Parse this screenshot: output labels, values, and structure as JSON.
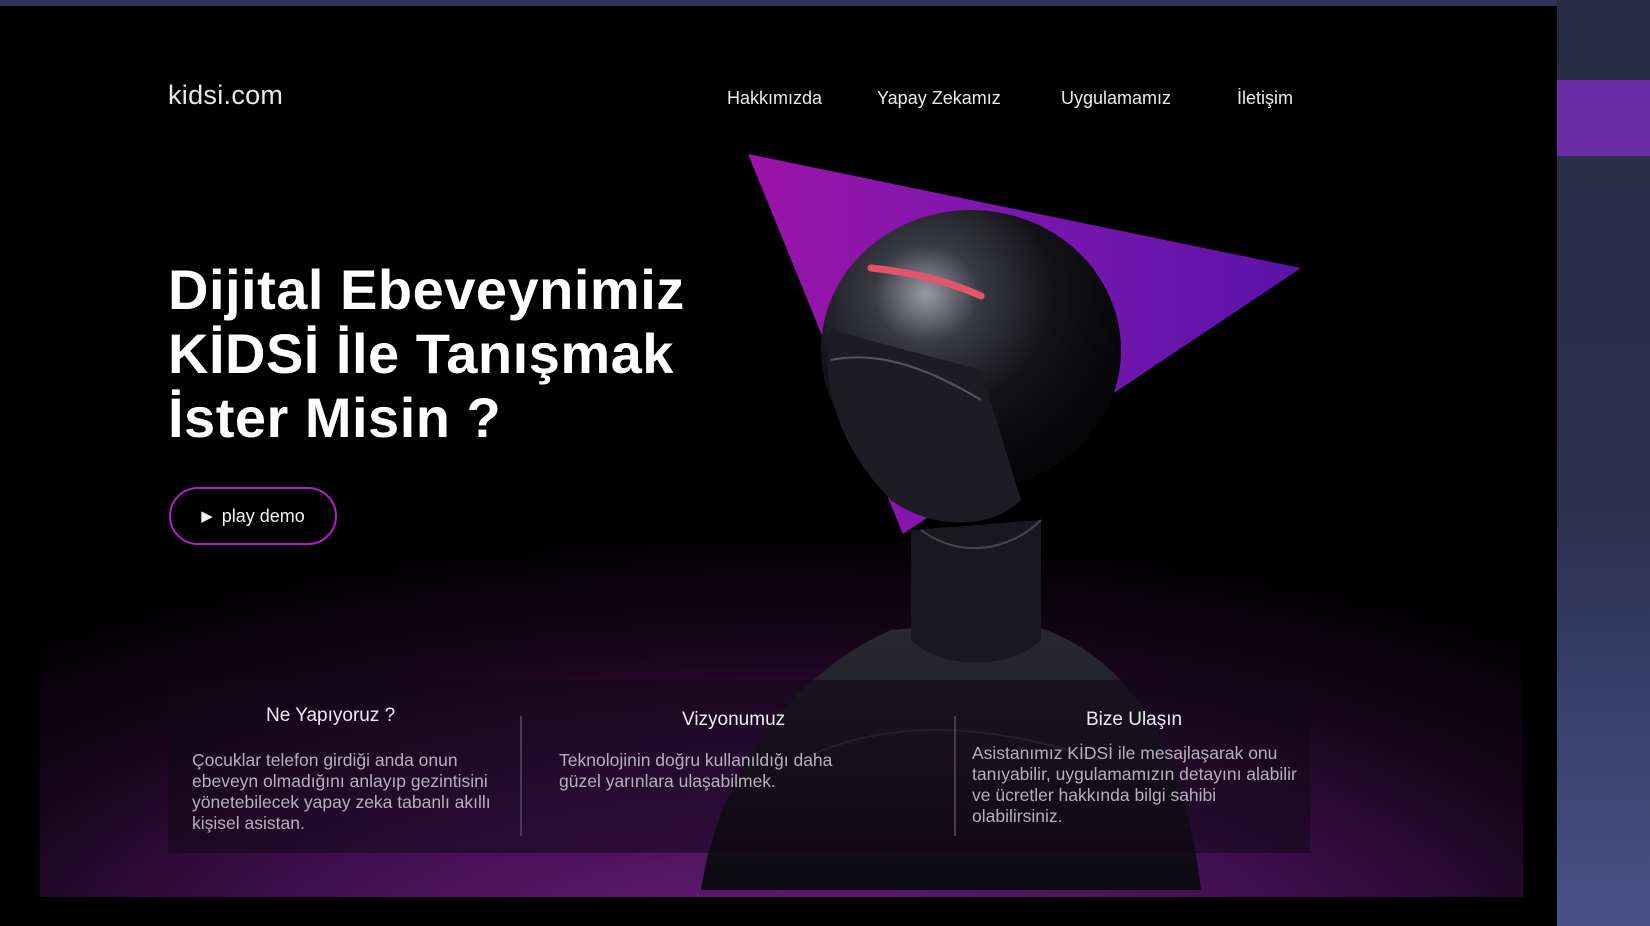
{
  "site": {
    "logo": "kidsi.com"
  },
  "nav": {
    "items": [
      "Hakkımızda",
      "Yapay Zekamız",
      "Uygulamamız",
      "İletişim"
    ]
  },
  "hero": {
    "title_lines": [
      "Dijital Ebeveynimiz",
      "KİDSİ İle Tanışmak",
      "İster Misin ?"
    ],
    "demo_button": {
      "icon": "play-icon",
      "label": "play demo"
    }
  },
  "info": [
    {
      "title": "Ne Yapıyoruz ?",
      "text": "Çocuklar telefon girdiği anda onun ebeveyn olmadığını anlayıp gezintisini yönetebilecek yapay zeka tabanlı akıllı kişisel asistan."
    },
    {
      "title": "Vizyonumuz",
      "text": "Teknolojinin doğru kullanıldığı daha güzel yarınlara ulaşabilmek."
    },
    {
      "title": "Bize Ulaşın",
      "text": "Asistanımız KİDSİ ile mesajlaşarak onu tanıyabilir, uygulamamızın detayını alabilir ve ücretler hakkında bilgi sahibi olabilirsiniz."
    }
  ],
  "colors": {
    "accent_purple": "#b020c8",
    "triangle": "#7d17b0",
    "background": "#000000"
  }
}
